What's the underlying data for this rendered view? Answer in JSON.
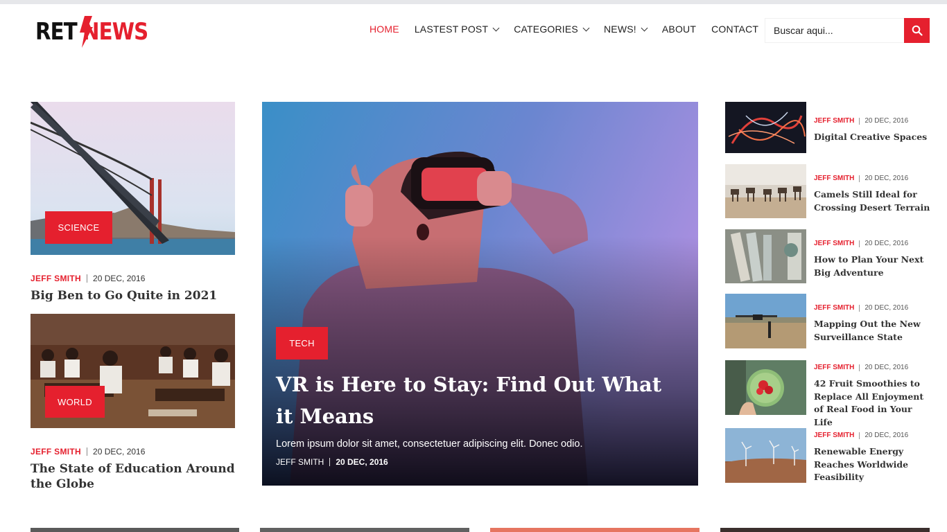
{
  "brand": {
    "logo_left": "RET",
    "logo_right": "NEWS",
    "accent": "#e5202e"
  },
  "nav": {
    "items": [
      {
        "label": "HOME",
        "active": true,
        "dropdown": false
      },
      {
        "label": "LASTEST POST",
        "active": false,
        "dropdown": true
      },
      {
        "label": "CATEGORIES",
        "active": false,
        "dropdown": true
      },
      {
        "label": "NEWS!",
        "active": false,
        "dropdown": true
      },
      {
        "label": "ABOUT",
        "active": false,
        "dropdown": false
      },
      {
        "label": "CONTACT",
        "active": false,
        "dropdown": false
      }
    ],
    "search": {
      "placeholder": "Buscar aqui...",
      "icon": "search-icon"
    }
  },
  "left_posts": [
    {
      "category": "SCIENCE",
      "author": "JEFF SMITH",
      "date": "20 DEC, 2016",
      "title": "Big Ben to Go Quite in 2021",
      "image": "golden-gate-bridge"
    },
    {
      "category": "WORLD",
      "author": "JEFF SMITH",
      "date": "20 DEC, 2016",
      "title": "The State of Education Around the Globe",
      "image": "classroom-children"
    }
  ],
  "hero": {
    "category": "TECH",
    "title": "VR is Here to Stay: Find Out What it Means",
    "excerpt": "Lorem ipsum dolor sit amet, consectetuer adipiscing elit. Donec odio.",
    "author": "JEFF SMITH",
    "date": "20 DEC, 2016",
    "image": "child-vr-headset"
  },
  "side_posts": [
    {
      "author": "JEFF SMITH",
      "date": "20 DEC, 2016",
      "title": "Digital Creative Spaces",
      "image": "light-painting"
    },
    {
      "author": "JEFF SMITH",
      "date": "20 DEC, 2016",
      "title": "Camels Still Ideal for Crossing Desert Terrain",
      "image": "camel-caravan"
    },
    {
      "author": "JEFF SMITH",
      "date": "20 DEC, 2016",
      "title": "How to Plan Your Next Big Adventure",
      "image": "rolled-maps"
    },
    {
      "author": "JEFF SMITH",
      "date": "20 DEC, 2016",
      "title": "Mapping Out the New Surveillance State",
      "image": "drone-field"
    },
    {
      "author": "JEFF SMITH",
      "date": "20 DEC, 2016",
      "title": "42 Fruit Smoothies to Replace All Enjoyment of Real Food in Your Life",
      "image": "smoothie-bowl"
    },
    {
      "author": "JEFF SMITH",
      "date": "20 DEC, 2016",
      "title": "Renewable Energy Reaches Worldwide Feasibility",
      "image": "wind-turbines"
    }
  ]
}
